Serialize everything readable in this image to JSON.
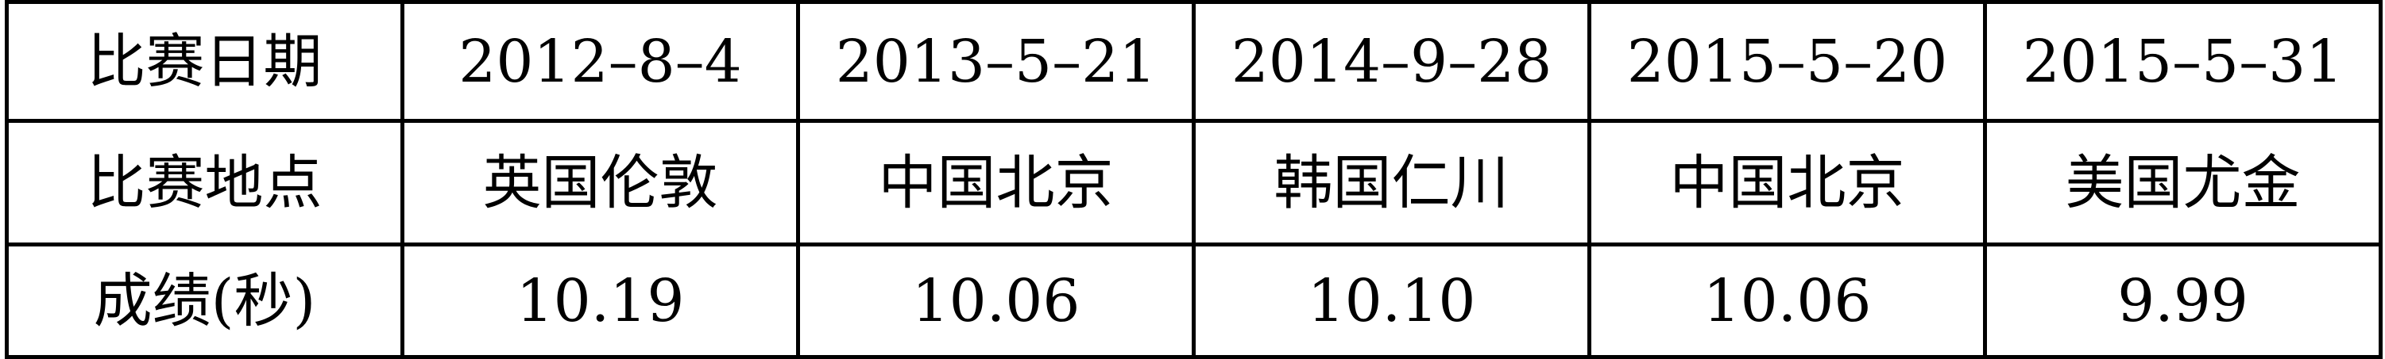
{
  "table": {
    "rows": [
      {
        "header": "比赛日期",
        "cells": [
          "2012–8–4",
          "2013–5–21",
          "2014–9–28",
          "2015–5–20",
          "2015–5–31"
        ]
      },
      {
        "header": "比赛地点",
        "cells": [
          "英国伦敦",
          "中国北京",
          "韩国仁川",
          "中国北京",
          "美国尤金"
        ]
      },
      {
        "header": "成绩(秒)",
        "cells": [
          "10.19",
          "10.06",
          "10.10",
          "10.06",
          "9.99"
        ]
      }
    ]
  }
}
